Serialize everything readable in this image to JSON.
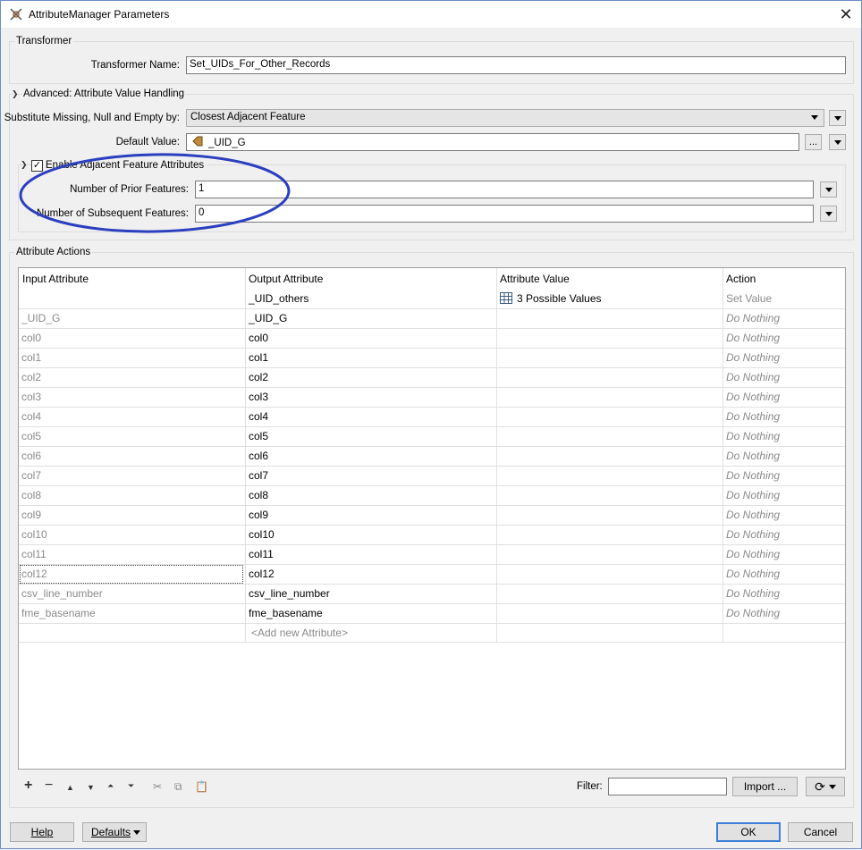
{
  "window": {
    "title": "AttributeManager Parameters"
  },
  "transformer": {
    "group_title": "Transformer",
    "name_label": "Transformer Name:",
    "name_value": "Set_UIDs_For_Other_Records"
  },
  "advanced": {
    "group_title": "Advanced: Attribute Value Handling",
    "substitute_label": "Substitute Missing, Null and Empty by:",
    "substitute_value": "Closest Adjacent Feature",
    "default_label": "Default Value:",
    "default_value": "_UID_G",
    "ellipsis": "...",
    "adjacent": {
      "checkbox_label": "Enable Adjacent Feature Attributes",
      "checked": true,
      "prior_label": "Number of Prior Features:",
      "prior_value": "1",
      "subsequent_label": "Number of Subsequent Features:",
      "subsequent_value": "0"
    },
    "highlight_color": "#2b3fbf"
  },
  "actions": {
    "group_title": "Attribute Actions",
    "headers": [
      "Input Attribute",
      "Output Attribute",
      "Attribute Value",
      "Action"
    ],
    "subheader": {
      "output": "_UID_others",
      "value": "3 Possible Values",
      "action": "Set Value"
    },
    "rows": [
      {
        "input": "_UID_G",
        "output": "_UID_G",
        "action": "Do Nothing"
      },
      {
        "input": "col0",
        "output": "col0",
        "action": "Do Nothing"
      },
      {
        "input": "col1",
        "output": "col1",
        "action": "Do Nothing"
      },
      {
        "input": "col2",
        "output": "col2",
        "action": "Do Nothing"
      },
      {
        "input": "col3",
        "output": "col3",
        "action": "Do Nothing"
      },
      {
        "input": "col4",
        "output": "col4",
        "action": "Do Nothing"
      },
      {
        "input": "col5",
        "output": "col5",
        "action": "Do Nothing"
      },
      {
        "input": "col6",
        "output": "col6",
        "action": "Do Nothing"
      },
      {
        "input": "col7",
        "output": "col7",
        "action": "Do Nothing"
      },
      {
        "input": "col8",
        "output": "col8",
        "action": "Do Nothing"
      },
      {
        "input": "col9",
        "output": "col9",
        "action": "Do Nothing"
      },
      {
        "input": "col10",
        "output": "col10",
        "action": "Do Nothing"
      },
      {
        "input": "col11",
        "output": "col11",
        "action": "Do Nothing"
      },
      {
        "input": "col12",
        "output": "col12",
        "action": "Do Nothing"
      },
      {
        "input": "csv_line_number",
        "output": "csv_line_number",
        "action": "Do Nothing"
      },
      {
        "input": "fme_basename",
        "output": "fme_basename",
        "action": "Do Nothing"
      }
    ],
    "add_new": "<Add new Attribute>"
  },
  "toolbar": {
    "filter_label": "Filter:",
    "filter_value": "",
    "import_label": "Import ..."
  },
  "footer": {
    "help": "Help",
    "defaults": "Defaults",
    "ok": "OK",
    "cancel": "Cancel"
  }
}
